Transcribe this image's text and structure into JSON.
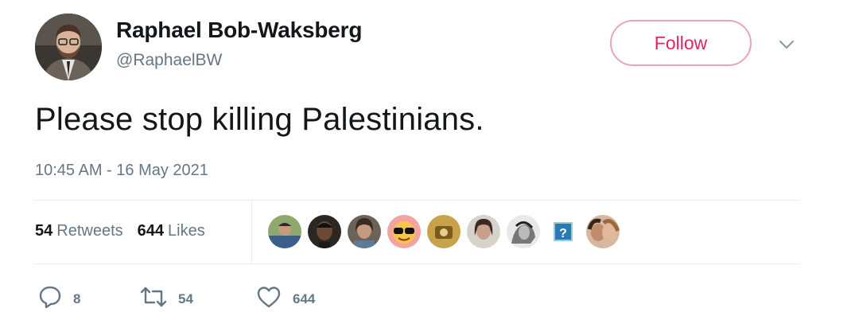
{
  "user": {
    "display_name": "Raphael Bob-Waksberg",
    "handle": "@RaphaelBW"
  },
  "header": {
    "follow_label": "Follow",
    "menu_icon": "chevron-down-icon"
  },
  "tweet": {
    "text": "Please stop killing Palestinians.",
    "timestamp": "10:45 AM - 16 May 2021"
  },
  "stats": {
    "retweets_count": "54",
    "retweets_label": "Retweets",
    "likes_count": "644",
    "likes_label": "Likes"
  },
  "likers": [
    {
      "name": "liker-avatar-1"
    },
    {
      "name": "liker-avatar-2"
    },
    {
      "name": "liker-avatar-3"
    },
    {
      "name": "liker-avatar-4"
    },
    {
      "name": "liker-avatar-5"
    },
    {
      "name": "liker-avatar-6"
    },
    {
      "name": "liker-avatar-7"
    },
    {
      "name": "liker-avatar-8"
    },
    {
      "name": "liker-avatar-9"
    }
  ],
  "actions": {
    "reply_count": "8",
    "retweet_count": "54",
    "like_count": "644"
  },
  "colors": {
    "follow_accent": "#e0245e",
    "secondary_text": "#657786",
    "primary_text": "#14171a",
    "divider": "#e6ecf0"
  }
}
